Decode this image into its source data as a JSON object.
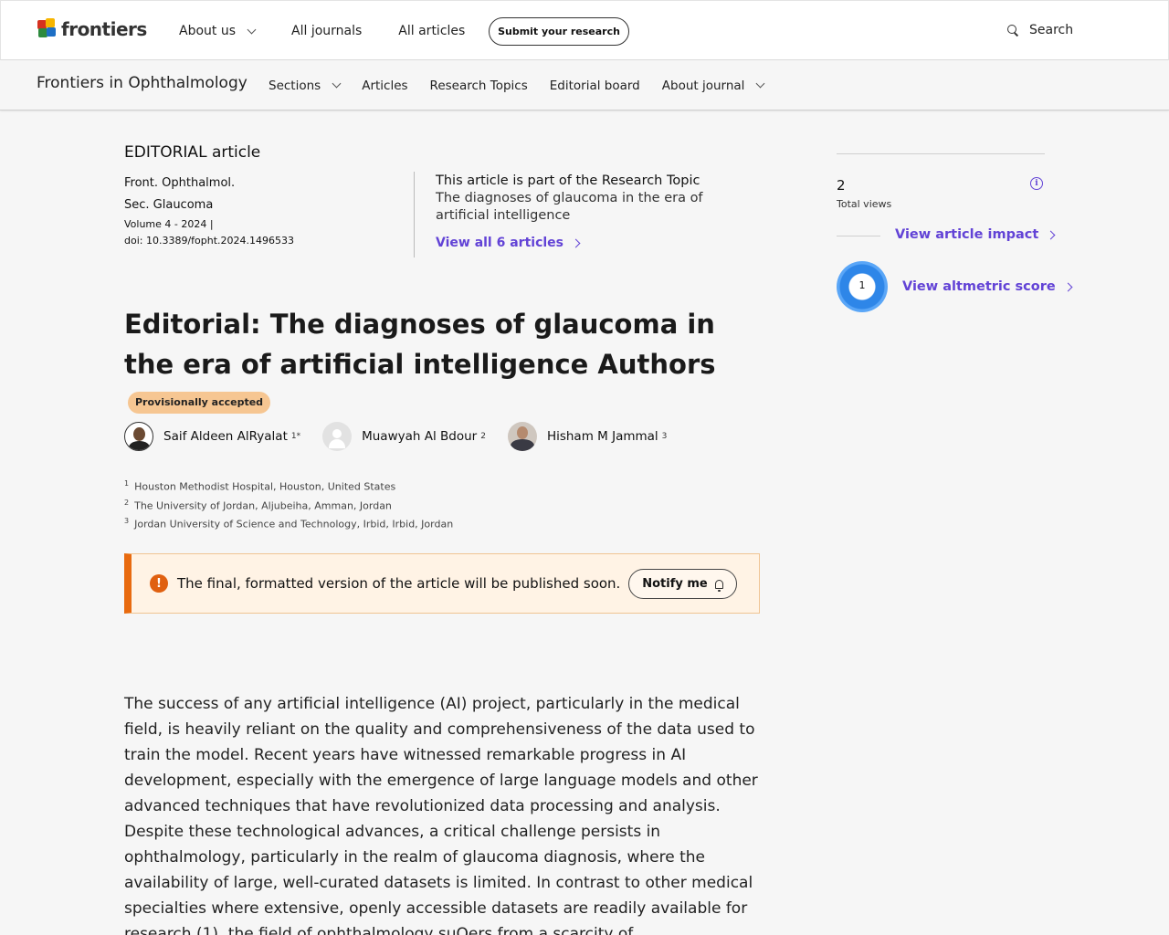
{
  "header": {
    "logo_text": "frontiers",
    "nav": [
      "About us",
      "All journals",
      "All articles"
    ],
    "submit_label": "Submit your research",
    "search_label": "Search"
  },
  "journal_bar": {
    "journal_name": "Frontiers in Ophthalmology",
    "nav": [
      "Sections",
      "Articles",
      "Research Topics",
      "Editorial board",
      "About journal"
    ]
  },
  "article": {
    "type": "EDITORIAL article",
    "journal": "Front. Ophthalmol.",
    "section": "Sec. Glaucoma",
    "volume": "Volume 4 - 2024 |",
    "doi": "doi: 10.3389/fopht.2024.1496533",
    "topic_heading": "This article is part of the Research Topic",
    "topic_name": "The diagnoses of glaucoma in the era of artificial intelligence",
    "view_all": "View all 6 articles",
    "title": "Editorial: The diagnoses of glaucoma in the era of artificial intelligence Authors",
    "badge": "Provisionally accepted",
    "authors": [
      {
        "name": "Saif Aldeen AlRyalat",
        "sup": "1*"
      },
      {
        "name": "Muawyah Al Bdour",
        "sup": "2"
      },
      {
        "name": "Hisham M Jammal",
        "sup": "3"
      }
    ],
    "affiliations": [
      {
        "n": "1",
        "text": "Houston Methodist Hospital, Houston, United States"
      },
      {
        "n": "2",
        "text": "The University of Jordan, Aljubeiha, Amman, Jordan"
      },
      {
        "n": "3",
        "text": "Jordan University of Science and Technology, Irbid, Irbid, Jordan"
      }
    ],
    "notice_icon": "!",
    "notice": "The final, formatted version of the article will be published soon.",
    "notify_label": "Notify me",
    "body": "The success of any artificial intelligence (AI) project, particularly in the medical field, is heavily reliant on the quality and comprehensiveness of the data used to train the model. Recent years have witnessed remarkable progress in AI development, especially with the emergence of large language models and other advanced techniques that have revolutionized data processing and analysis. Despite these technological advances, a critical challenge persists in ophthalmology, particularly in the realm of glaucoma diagnosis, where the availability of large, well-curated datasets is limited. In contrast to other medical specialties where extensive, openly accessible datasets are readily available for research (1), the field of ophthalmology suΟers from a scarcity of comprehensive, structured datasets. The few datasets that"
  },
  "metrics": {
    "total_views_value": "2",
    "total_views_label": "Total views",
    "info_icon": "i",
    "impact_link": "View article impact",
    "altmetric_score": "1",
    "altmetric_link": "View altmetric score"
  },
  "colors": {
    "accent": "#6243d6",
    "warning": "#e86a0f",
    "badge": "#f6c692"
  }
}
